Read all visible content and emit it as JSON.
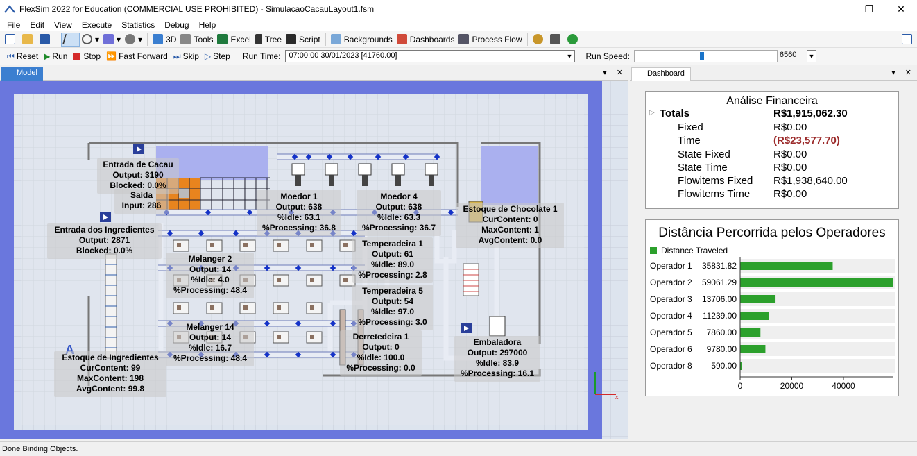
{
  "window": {
    "title": "FlexSim 2022 for Education (COMMERCIAL USE PROHIBITED) - SimulacaoCacauLayout1.fsm",
    "minimize": "—",
    "maximize": "❐",
    "close": "✕"
  },
  "menu": [
    "File",
    "Edit",
    "View",
    "Execute",
    "Statistics",
    "Debug",
    "Help"
  ],
  "toolbar": {
    "three_d": "3D",
    "tools": "Tools",
    "excel": "Excel",
    "tree": "Tree",
    "script": "Script",
    "backgrounds": "Backgrounds",
    "dashboards": "Dashboards",
    "process_flow": "Process Flow"
  },
  "runbar": {
    "reset": "Reset",
    "run": "Run",
    "stop": "Stop",
    "fast_forward": "Fast Forward",
    "skip": "Skip",
    "step": "Step",
    "run_time_label": "Run Time:",
    "run_time_value": "07:00:00  30/01/2023  [41760.00]",
    "run_speed_label": "Run Speed:",
    "run_speed_value": "6560",
    "run_speed_fraction": 0.47
  },
  "model_tab": "Model",
  "dashboard_tab": "Dashboard",
  "model_labels": [
    {
      "lines": [
        "Entrada de Cacau",
        "Output: 3190",
        "Blocked: 0.0%"
      ]
    },
    {
      "lines": [
        "Saída",
        "Input: 286"
      ]
    },
    {
      "lines": [
        "Entrada dos Ingredientes",
        "Output: 2871",
        "Blocked: 0.0%"
      ]
    },
    {
      "lines": [
        "Moedor 1",
        "Output: 638",
        "%Idle:  63.1",
        "%Processing: 36.8"
      ]
    },
    {
      "lines": [
        "Moedor 4",
        "Output: 638",
        "%Idle:  63.3",
        "%Processing: 36.7"
      ]
    },
    {
      "lines": [
        "Estoque de Chocolate 1",
        "CurContent:  0",
        "MaxContent:  1",
        "AvgContent:  0.0"
      ]
    },
    {
      "lines": [
        "Temperadeira 1",
        "Output: 61",
        "%Idle:  89.0",
        "%Processing: 2.8"
      ]
    },
    {
      "lines": [
        "Melanger 2",
        "Output: 14",
        "%Idle:  4.0",
        "%Processing: 48.4"
      ]
    },
    {
      "lines": [
        "Temperadeira 5",
        "Output: 54",
        "%Idle:  97.0",
        "%Processing: 3.0"
      ]
    },
    {
      "lines": [
        "Melanger 14",
        "Output: 14",
        "%Idle:  16.7",
        "%Processing: 48.4"
      ]
    },
    {
      "lines": [
        "Derretedeira 1",
        "Output: 0",
        "%Idle:  100.0",
        "%Processing: 0.0"
      ]
    },
    {
      "lines": [
        "Embaladora",
        "Output: 297000",
        "%Idle:  83.9",
        "%Processing: 16.1"
      ]
    },
    {
      "lines": [
        "Estoque de Ingredientes",
        "CurContent:  99",
        "MaxContent:  198",
        "AvgContent:  99.8"
      ]
    }
  ],
  "finance": {
    "title": "Análise Financeira",
    "rows": [
      {
        "label": "Totals",
        "value": "R$1,915,062.30"
      },
      {
        "label": "Fixed",
        "value": "R$0.00"
      },
      {
        "label": "Time",
        "value": "(R$23,577.70)"
      },
      {
        "label": "State Fixed",
        "value": "R$0.00"
      },
      {
        "label": "State Time",
        "value": "R$0.00"
      },
      {
        "label": "Flowitems Fixed",
        "value": "R$1,938,640.00"
      },
      {
        "label": "Flowitems Time",
        "value": "R$0.00"
      }
    ]
  },
  "chart_data": {
    "type": "bar",
    "orientation": "horizontal",
    "title": "Distância Percorrida pelos Operadores",
    "legend": "top-left",
    "series": [
      {
        "name": "Distance Traveled",
        "color": "#2ca02c",
        "values": [
          35831.82,
          59061.29,
          13706.0,
          11239.0,
          7860.0,
          9780.0,
          590.0
        ]
      }
    ],
    "categories": [
      "Operador 1",
      "Operador 2",
      "Operador 3",
      "Operador 4",
      "Operador 5",
      "Operador 6",
      "Operador 8"
    ],
    "value_labels": [
      "35831.82",
      "59061.29",
      "13706.00",
      "11239.00",
      "7860.00",
      "9780.00",
      "590.00"
    ],
    "xticks": [
      "0",
      "20000",
      "40000"
    ],
    "xlim": [
      0,
      59061.29
    ]
  },
  "status": "Done Binding Objects."
}
